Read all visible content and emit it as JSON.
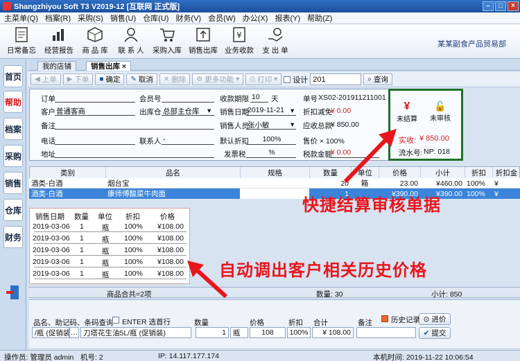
{
  "window": {
    "title": "Shangzhiyou Soft T3 V2019-12 [互联网 正式版]"
  },
  "menu": [
    "主菜单(Q)",
    "档案(R)",
    "采购(S)",
    "销售(U)",
    "仓库(U)",
    "财务(V)",
    "会员(W)",
    "办公(X)",
    "报表(Y)",
    "帮助(Z)"
  ],
  "ribbon": {
    "items": [
      "日常备忘",
      "经营报告",
      "商 品 库",
      "联 系 人",
      "采购入库",
      "销售出库",
      "业务收款",
      "支 出 单"
    ],
    "company": "某某副食产品贸易部"
  },
  "sidebar": [
    "首页",
    "帮助",
    "档案",
    "采购",
    "销售",
    "仓库",
    "财务"
  ],
  "tabs": [
    "我的店铺",
    "销售出库"
  ],
  "toolbar": {
    "prev": "上单",
    "next": "下单",
    "confirm": "确定",
    "cancel": "取消",
    "delete": "删除",
    "more": "更多功能",
    "print": "打印",
    "design": "设计",
    "search_value": "201",
    "query": "查询"
  },
  "form": {
    "order_label": "订单",
    "order_value": "",
    "customer_label": "客户",
    "customer_value": "普通客商",
    "note_label": "备注",
    "note_value": "",
    "phone_label": "电话",
    "phone_value": "",
    "address_label": "地址",
    "address_value": "",
    "member_label": "会员号",
    "member_value": "",
    "warehouse_label": "出库仓",
    "warehouse_value": "总部主仓库",
    "contact_label": "联系人",
    "contact_value": "-",
    "term_label": "收款期限",
    "term_value": "10",
    "term_unit": "天",
    "date_label": "销售日期",
    "date_value": "2019-11-21",
    "seller_label": "销售人员",
    "seller_value": "张小敏",
    "discount_label": "默认折扣",
    "discount_value": "100%",
    "tax_label": "发票税",
    "tax_value": "%",
    "bill_label": "单号",
    "bill_value": "XS02-201911211001",
    "reduce_label": "折扣减免",
    "reduce_value": "¥ 0.00",
    "due_label": "应收总款",
    "due_value": "¥ 850.00",
    "price_label": "售价 × 100%",
    "taxamt_label": "税款金额",
    "taxamt_value": "¥ 0.00",
    "settle_label": "未结算",
    "audit_label": "未审核",
    "received_label": "实收:",
    "received_value": "¥ 850.00",
    "serial_label": "流水号:",
    "serial_value": "NP: 018"
  },
  "grid": {
    "headers": [
      "类别",
      "品名",
      "规格",
      "数量",
      "单位",
      "价格",
      "小计",
      "折扣",
      "折扣金"
    ],
    "rows": [
      [
        "酒类-白酒",
        "烟台宝",
        "",
        "20",
        "箱",
        "23.00",
        "¥460.00",
        "100%",
        "¥"
      ],
      [
        "酒类-白酒",
        "康师傅酸菜牛肉面",
        "",
        "1",
        "",
        "¥390.00",
        "¥390.00",
        "100%",
        "¥"
      ]
    ]
  },
  "history": {
    "headers": [
      "销售日期",
      "数量",
      "单位",
      "折扣",
      "价格"
    ],
    "rows": [
      [
        "2019-03-06",
        "1",
        "瓶",
        "100%",
        "¥108.00"
      ],
      [
        "2019-03-06",
        "1",
        "瓶",
        "100%",
        "¥108.00"
      ],
      [
        "2019-03-06",
        "1",
        "瓶",
        "100%",
        "¥108.00"
      ],
      [
        "2019-03-06",
        "1",
        "瓶",
        "100%",
        "¥108.00"
      ],
      [
        "2019-03-06",
        "1",
        "瓶",
        "100%",
        "¥108.00"
      ]
    ]
  },
  "summary": {
    "items": "商品合共=2项",
    "qty": "数量: 30",
    "subtotal": "小计: 850"
  },
  "entry": {
    "search_label": "品名、助记码、条码查询",
    "enter_label": "ENTER 选首行",
    "qty_label": "数量",
    "price_label": "价格",
    "discount_label": "折扣",
    "total_label": "合计",
    "note_label": "备注",
    "history_label": "历史记录",
    "add_button": "进价",
    "search_value": "/瓶 (促销装)",
    "product_value": "刀塔花生油5L/瓶 (促销装)",
    "qty_value": "1",
    "unit_value": "瓶",
    "price_value": "108",
    "discount_value": "100%",
    "total_value": "¥ 108.00",
    "submit_button": "提交"
  },
  "status": {
    "user": "操作员: 管理员 admin",
    "machine": "机号: 2",
    "ip": "IP: 14.117.177.174",
    "time": "本机时间: 2019-11-22 10:06:54"
  },
  "annotations": {
    "quick_settle": "快捷结算审核单据",
    "auto_history": "自动调出客户相关历史价格"
  },
  "colors": {
    "accent": "#3b84d9",
    "annotation": "#e8161c",
    "green_frame": "#1f6f2a"
  }
}
